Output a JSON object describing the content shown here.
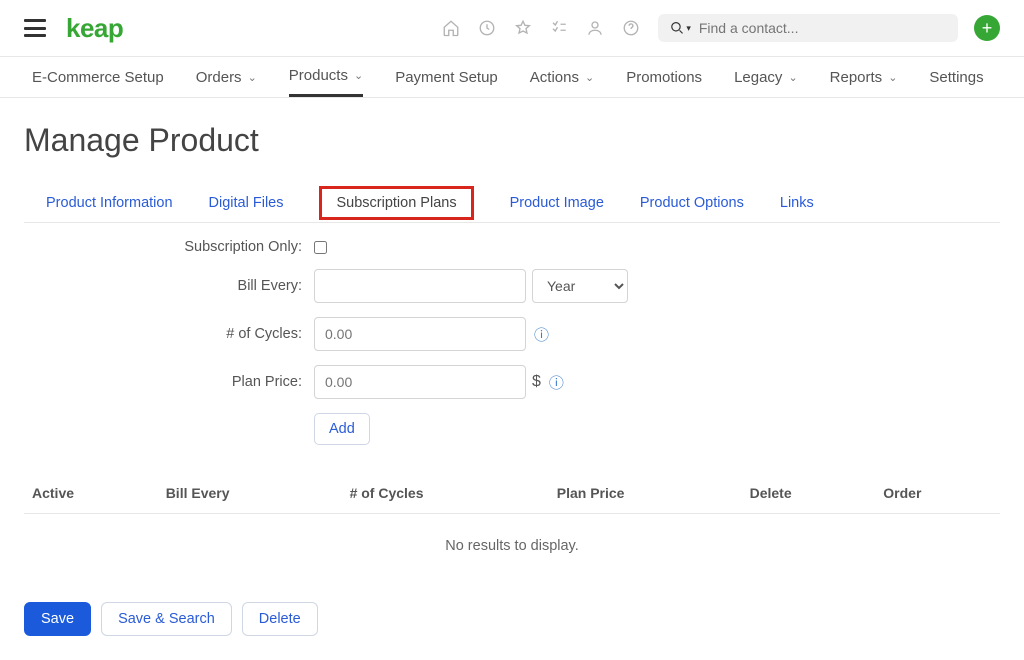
{
  "header": {
    "logo": "keap",
    "search_placeholder": "Find a contact..."
  },
  "mainnav": {
    "items": [
      {
        "label": "E-Commerce Setup",
        "dd": false
      },
      {
        "label": "Orders",
        "dd": true
      },
      {
        "label": "Products",
        "dd": true,
        "active": true
      },
      {
        "label": "Payment Setup",
        "dd": false
      },
      {
        "label": "Actions",
        "dd": true
      },
      {
        "label": "Promotions",
        "dd": false
      },
      {
        "label": "Legacy",
        "dd": true
      },
      {
        "label": "Reports",
        "dd": true
      },
      {
        "label": "Settings",
        "dd": false
      }
    ]
  },
  "page_title": "Manage Product",
  "tabs": [
    {
      "label": "Product Information"
    },
    {
      "label": "Digital Files"
    },
    {
      "label": "Subscription Plans",
      "active": true
    },
    {
      "label": "Product  Image"
    },
    {
      "label": "Product  Options"
    },
    {
      "label": "Links"
    }
  ],
  "form": {
    "subscription_only_label": "Subscription Only:",
    "bill_every_label": "Bill Every:",
    "bill_every_unit_selected": "Year",
    "cycles_label": "# of Cycles:",
    "cycles_placeholder": "0.00",
    "plan_price_label": "Plan Price:",
    "plan_price_placeholder": "0.00",
    "currency_symbol": "$",
    "add_button": "Add"
  },
  "table": {
    "headers": [
      "Active",
      "Bill Every",
      "# of Cycles",
      "Plan Price",
      "Delete",
      "Order"
    ],
    "empty_message": "No results to display."
  },
  "actions": {
    "save": "Save",
    "save_search": "Save & Search",
    "delete": "Delete"
  }
}
